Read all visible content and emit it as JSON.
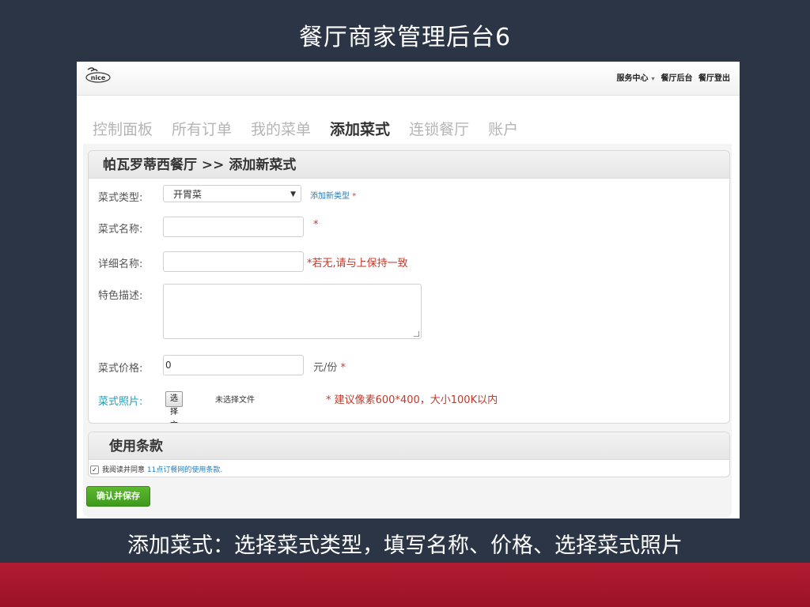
{
  "slide": {
    "title": "餐厅商家管理后台6",
    "caption": "添加菜式：选择菜式类型，填写名称、价格、选择菜式照片"
  },
  "header": {
    "logo_text": "nice",
    "links": [
      "服务中心",
      "餐厅后台",
      "餐厅登出"
    ]
  },
  "nav": {
    "tabs": [
      {
        "label": "控制面板",
        "active": false
      },
      {
        "label": "所有订单",
        "active": false
      },
      {
        "label": "我的菜单",
        "active": false
      },
      {
        "label": "添加菜式",
        "active": true
      },
      {
        "label": "连锁餐厅",
        "active": false
      },
      {
        "label": "账户",
        "active": false
      }
    ]
  },
  "form": {
    "heading": "帕瓦罗蒂西餐厅 >> 添加新菜式",
    "type_label": "菜式类型:",
    "type_value": "开胃菜",
    "add_type_link": "添加新类型",
    "required_mark": "*",
    "name_label": "菜式名称:",
    "name_value": "",
    "detail_label": "详细名称:",
    "detail_value": "",
    "detail_hint": "*若无,请与上保持一致",
    "desc_label": "特色描述:",
    "price_label": "菜式价格:",
    "price_value": "0",
    "price_unit": "元/份",
    "photo_label": "菜式照片:",
    "file_button": "选择文件",
    "file_status": "未选择文件",
    "photo_hint": "* 建议像素600*400，大小100K以内"
  },
  "terms": {
    "heading": "使用条款",
    "agree_text": "我阅读并同意",
    "agree_link": "11点订餐网的使用条款.",
    "checked": true
  },
  "actions": {
    "save_label": "确认并保存"
  },
  "colors": {
    "background": "#2b3545",
    "accent_green": "#4aa524",
    "link_blue": "#2a7ab0",
    "hint_red": "#c0392b",
    "band_red": "#a9182b"
  }
}
